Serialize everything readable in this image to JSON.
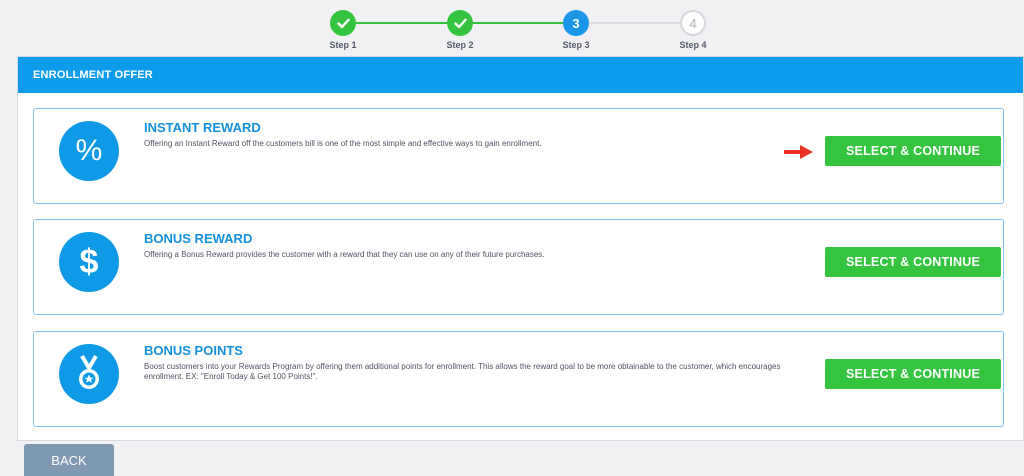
{
  "stepper": {
    "steps": [
      {
        "label": "Step 1",
        "number": "1",
        "state": "done"
      },
      {
        "label": "Step 2",
        "number": "2",
        "state": "done"
      },
      {
        "label": "Step 3",
        "number": "3",
        "state": "active"
      },
      {
        "label": "Step 4",
        "number": "4",
        "state": "todo"
      }
    ],
    "done_icon": "check-icon"
  },
  "panel": {
    "header": "ENROLLMENT OFFER",
    "offers": [
      {
        "icon": "percent-icon",
        "icon_glyph": "%",
        "title": "INSTANT REWARD",
        "description": "Offering an Instant Reward off the customers bill is one of the most simple and effective ways to gain enrollment.",
        "button_label": "SELECT & CONTINUE"
      },
      {
        "icon": "dollar-icon",
        "icon_glyph": "$",
        "title": "BONUS REWARD",
        "description": "Offering a Bonus Reward provides the customer with a reward that they can use on any of their future purchases.",
        "button_label": "SELECT & CONTINUE"
      },
      {
        "icon": "medal-icon",
        "title": "BONUS POINTS",
        "description": "Boost customers into your Rewards Program by offering them additional points for enrollment. This allows the reward goal to be more obtainable to the customer, which encourages enrollment. EX: \"Enroll Today & Get 100 Points!\".",
        "button_label": "SELECT & CONTINUE"
      }
    ]
  },
  "back_label": "BACK",
  "colors": {
    "accent": "#0d9bec",
    "success": "#35c43f",
    "arrow": "#e8321f"
  }
}
